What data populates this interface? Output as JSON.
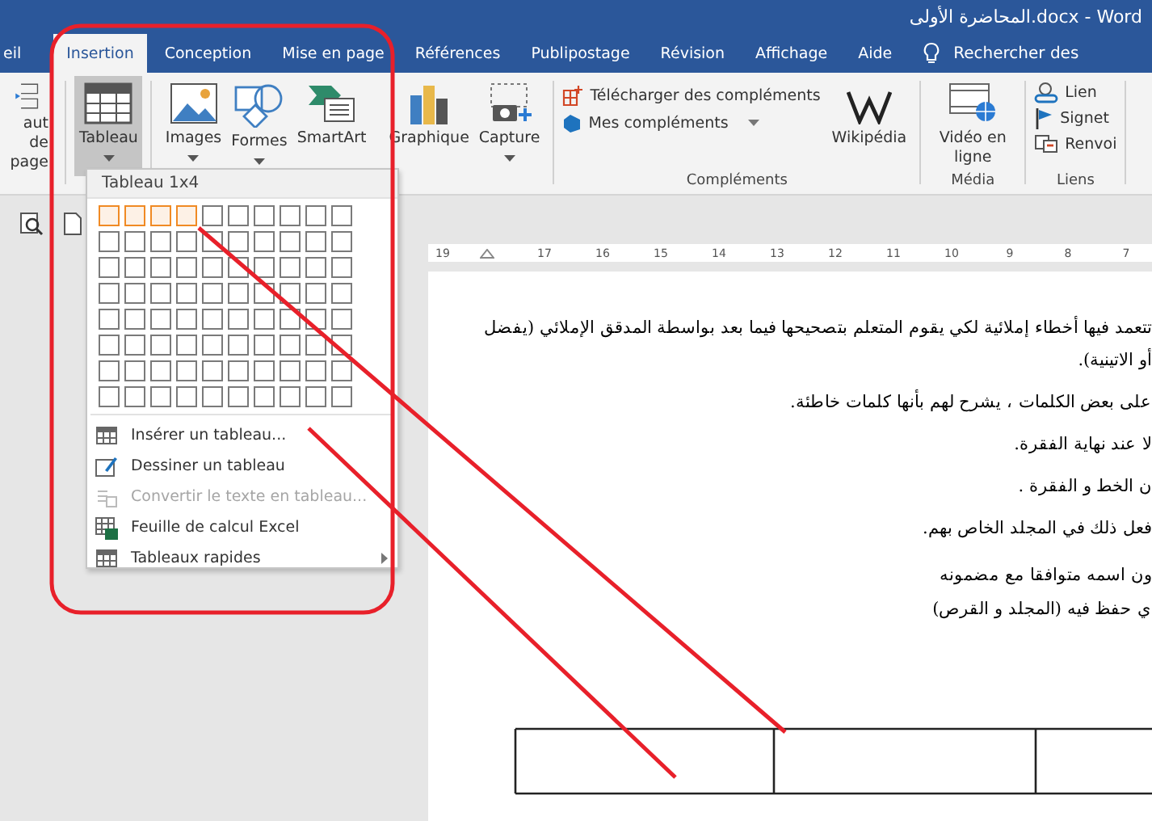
{
  "window": {
    "title": "المحاضرة الأولى.docx - Word"
  },
  "tabs": [
    {
      "label": "eil",
      "selected": false
    },
    {
      "label": "Insertion",
      "selected": true
    },
    {
      "label": "Conception",
      "selected": false
    },
    {
      "label": "Mise en page",
      "selected": false
    },
    {
      "label": "Références",
      "selected": false
    },
    {
      "label": "Publipostage",
      "selected": false
    },
    {
      "label": "Révision",
      "selected": false
    },
    {
      "label": "Affichage",
      "selected": false
    },
    {
      "label": "Aide",
      "selected": false
    }
  ],
  "tell_me": {
    "label": "Rechercher des"
  },
  "ribbon": {
    "page_break": {
      "label": "aut de page"
    },
    "table": {
      "label": "Tableau",
      "pressed": true
    },
    "images": {
      "label": "Images"
    },
    "shapes": {
      "label": "Formes"
    },
    "smartart": {
      "label": "SmartArt"
    },
    "chart": {
      "label": "Graphique"
    },
    "screenshot": {
      "label": "Capture"
    },
    "addins": {
      "get": "Télécharger des compléments",
      "mine": "Mes compléments",
      "wikipedia": "Wikipédia",
      "group": "Compléments"
    },
    "media": {
      "video": "Vidéo en ligne",
      "group": "Média"
    },
    "links": {
      "link": "Lien",
      "bookmark": "Signet",
      "cross_ref": "Renvoi",
      "group": "Liens"
    }
  },
  "table_menu": {
    "header": "Tableau 1x4",
    "grid": [
      [
        {
          "selected": true
        },
        {
          "selected": true
        },
        {
          "selected": true
        },
        {
          "selected": true
        },
        {
          "selected": false
        },
        {
          "selected": false
        },
        {
          "selected": false
        },
        {
          "selected": false
        },
        {
          "selected": false
        },
        {
          "selected": false
        }
      ],
      [
        {
          "selected": false
        },
        {
          "selected": false
        },
        {
          "selected": false
        },
        {
          "selected": false
        },
        {
          "selected": false
        },
        {
          "selected": false
        },
        {
          "selected": false
        },
        {
          "selected": false
        },
        {
          "selected": false
        },
        {
          "selected": false
        }
      ],
      [
        {
          "selected": false
        },
        {
          "selected": false
        },
        {
          "selected": false
        },
        {
          "selected": false
        },
        {
          "selected": false
        },
        {
          "selected": false
        },
        {
          "selected": false
        },
        {
          "selected": false
        },
        {
          "selected": false
        },
        {
          "selected": false
        }
      ],
      [
        {
          "selected": false
        },
        {
          "selected": false
        },
        {
          "selected": false
        },
        {
          "selected": false
        },
        {
          "selected": false
        },
        {
          "selected": false
        },
        {
          "selected": false
        },
        {
          "selected": false
        },
        {
          "selected": false
        },
        {
          "selected": false
        }
      ],
      [
        {
          "selected": false
        },
        {
          "selected": false
        },
        {
          "selected": false
        },
        {
          "selected": false
        },
        {
          "selected": false
        },
        {
          "selected": false
        },
        {
          "selected": false
        },
        {
          "selected": false
        },
        {
          "selected": false
        },
        {
          "selected": false
        }
      ],
      [
        {
          "selected": false
        },
        {
          "selected": false
        },
        {
          "selected": false
        },
        {
          "selected": false
        },
        {
          "selected": false
        },
        {
          "selected": false
        },
        {
          "selected": false
        },
        {
          "selected": false
        },
        {
          "selected": false
        },
        {
          "selected": false
        }
      ],
      [
        {
          "selected": false
        },
        {
          "selected": false
        },
        {
          "selected": false
        },
        {
          "selected": false
        },
        {
          "selected": false
        },
        {
          "selected": false
        },
        {
          "selected": false
        },
        {
          "selected": false
        },
        {
          "selected": false
        },
        {
          "selected": false
        }
      ],
      [
        {
          "selected": false
        },
        {
          "selected": false
        },
        {
          "selected": false
        },
        {
          "selected": false
        },
        {
          "selected": false
        },
        {
          "selected": false
        },
        {
          "selected": false
        },
        {
          "selected": false
        },
        {
          "selected": false
        },
        {
          "selected": false
        }
      ]
    ],
    "items": [
      {
        "label": "Insérer un tableau...",
        "kind": "insert",
        "disabled": false,
        "submenu": false
      },
      {
        "label": "Dessiner un tableau",
        "kind": "draw",
        "disabled": false,
        "submenu": false
      },
      {
        "label": "Convertir le texte en tableau...",
        "kind": "convert",
        "disabled": true,
        "submenu": false
      },
      {
        "label": "Feuille de calcul Excel",
        "kind": "excel",
        "disabled": false,
        "submenu": false
      },
      {
        "label": "Tableaux rapides",
        "kind": "quick",
        "disabled": false,
        "submenu": true
      }
    ]
  },
  "ruler": [
    "19",
    "17",
    "16",
    "15",
    "14",
    "13",
    "12",
    "11",
    "10",
    "9",
    "8",
    "7"
  ],
  "paragraphs": [
    "تتعمد فيها أخطاء إملائية لكي يقوم المتعلم بتصحيحها فيما بعد بواسطة المدقق الإملائي (يفضل",
    "أو الاتينية).",
    "على بعض الكلمات ، يشرح لهم بأنها كلمات خاطئة.",
    "لا عند نهاية الفقرة.",
    "ن الخط و الفقرة .",
    "فعل ذلك في المجلد الخاص بهم.",
    "ون اسمه متوافقا مع مضمونه",
    "ي حفظ فيه (المجلد و القرص)"
  ]
}
